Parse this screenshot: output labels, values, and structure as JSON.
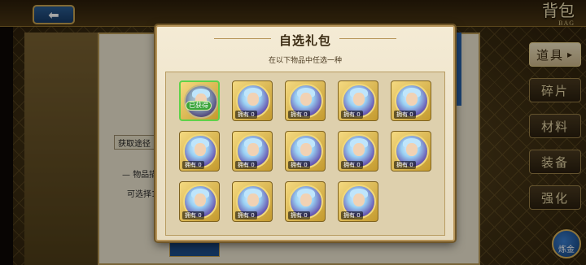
{
  "header": {
    "back_icon": "return-arrow-icon",
    "title": "背包",
    "title_en": "BAG"
  },
  "background": {
    "obtain_label": "获取途径",
    "item_desc_label": "物品描",
    "selectable_label": "可选择1"
  },
  "side_tabs": [
    {
      "label": "道具",
      "active": true
    },
    {
      "label": "碎片",
      "active": false
    },
    {
      "label": "材料",
      "active": false
    },
    {
      "label": "装备",
      "active": false
    },
    {
      "label": "强化",
      "active": false
    }
  ],
  "gold_button": {
    "label": "炼金"
  },
  "modal": {
    "title": "自选礼包",
    "subtitle": "在以下物品中任选一种",
    "items": [
      {
        "count_label": "",
        "badge": "已获得",
        "selected": true
      },
      {
        "count_label": "拥有 0",
        "badge": "",
        "selected": false
      },
      {
        "count_label": "拥有 0",
        "badge": "",
        "selected": false
      },
      {
        "count_label": "拥有 0",
        "badge": "",
        "selected": false
      },
      {
        "count_label": "拥有 0",
        "badge": "",
        "selected": false
      },
      {
        "count_label": "拥有 0",
        "badge": "",
        "selected": false
      },
      {
        "count_label": "拥有 0",
        "badge": "",
        "selected": false
      },
      {
        "count_label": "拥有 0",
        "badge": "",
        "selected": false
      },
      {
        "count_label": "拥有 0",
        "badge": "",
        "selected": false
      },
      {
        "count_label": "拥有 0",
        "badge": "",
        "selected": false
      },
      {
        "count_label": "拥有 0",
        "badge": "",
        "selected": false
      },
      {
        "count_label": "拥有 0",
        "badge": "",
        "selected": false
      },
      {
        "count_label": "拥有 0",
        "badge": "",
        "selected": false
      },
      {
        "count_label": "拥有 0",
        "badge": "",
        "selected": false
      }
    ]
  },
  "colors": {
    "accent_gold": "#c8a450",
    "selected_green": "#3aa43a",
    "panel_bg": "#f4ebd5"
  }
}
